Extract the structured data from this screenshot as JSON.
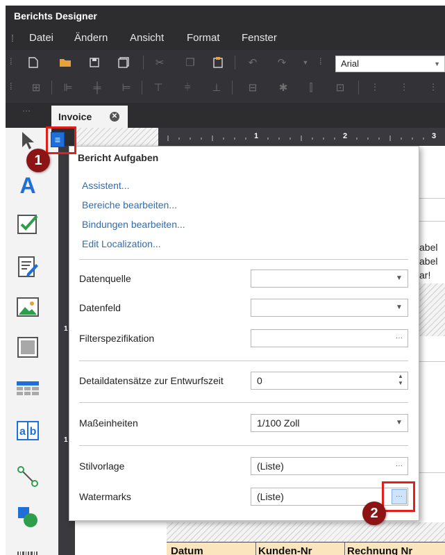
{
  "app": {
    "title": "Berichts Designer"
  },
  "menu": {
    "items": [
      "Datei",
      "Ändern",
      "Ansicht",
      "Format",
      "Fenster"
    ]
  },
  "toolbar": {
    "font": "Arial"
  },
  "tabs": [
    {
      "label": "Invoice",
      "active": true
    }
  ],
  "ruler": {
    "top_numbers": [
      "1",
      "2",
      "3"
    ],
    "left_numbers": [
      "1",
      "1"
    ]
  },
  "background": {
    "text_fragments": [
      "abel",
      "abel",
      "ar!"
    ],
    "table_headers": [
      "Datum",
      "Kunden-Nr",
      "Rechnung Nr"
    ]
  },
  "task_panel": {
    "title": "Bericht Aufgaben",
    "links": [
      "Assistent...",
      "Bereiche bearbeiten...",
      "Bindungen bearbeiten...",
      "Edit Localization..."
    ],
    "properties": {
      "datenquelle": {
        "label": "Datenquelle",
        "value": ""
      },
      "datenfeld": {
        "label": "Datenfeld",
        "value": ""
      },
      "filter": {
        "label": "Filterspezifikation",
        "value": ""
      },
      "detail": {
        "label": "Detaildatensätze zur Entwurfszeit",
        "value": "0"
      },
      "einheiten": {
        "label": "Maßeinheiten",
        "value": "1/100 Zoll"
      },
      "stilvorlage": {
        "label": "Stilvorlage",
        "value": "(Liste)"
      },
      "watermarks": {
        "label": "Watermarks",
        "value": "(Liste)"
      }
    }
  },
  "callouts": {
    "one": "1",
    "two": "2"
  },
  "colors": {
    "accent": "#1e6fd9",
    "callout": "#e0201b",
    "badge": "#8c1414",
    "link": "#2e6db4"
  }
}
